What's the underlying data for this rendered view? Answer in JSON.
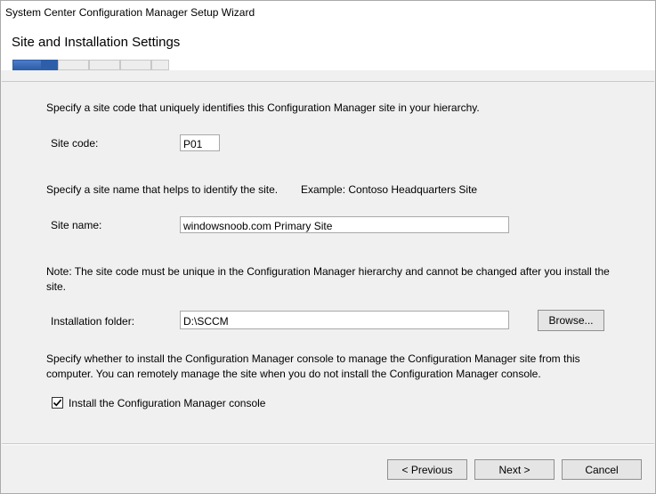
{
  "window": {
    "title": "System Center Configuration Manager Setup Wizard"
  },
  "header": {
    "heading": "Site and Installation Settings",
    "progress_steps_total": 5,
    "progress_completed_fraction": 0.3
  },
  "main": {
    "site_code_intro": "Specify a site code that uniquely identifies this Configuration Manager site in your hierarchy.",
    "site_code_label": "Site code:",
    "site_code_value": "P01",
    "site_name_intro": "Specify a site name that helps to identify the site.",
    "site_name_example": "Example: Contoso Headquarters Site",
    "site_name_label": "Site name:",
    "site_name_value": "windowsnoob.com Primary Site",
    "note": "Note: The site code must be unique in the Configuration Manager hierarchy and cannot be changed after you install the site.",
    "install_folder_label": "Installation folder:",
    "install_folder_value": "D:\\SCCM",
    "browse_label": "Browse...",
    "console_intro": "Specify whether to install the Configuration Manager console to manage the Configuration Manager site from this computer. You can remotely manage the site when you do not install the Configuration Manager console.",
    "install_console_label": "Install the Configuration Manager console",
    "install_console_checked": true
  },
  "footer": {
    "previous_label": "< Previous",
    "next_label": "Next >",
    "cancel_label": "Cancel"
  },
  "colors": {
    "progress_fill": "#2f5ea9",
    "panel": "#f0f0f0",
    "header_bg": "#ffffff"
  },
  "icons": {
    "checkbox": "check-icon"
  }
}
